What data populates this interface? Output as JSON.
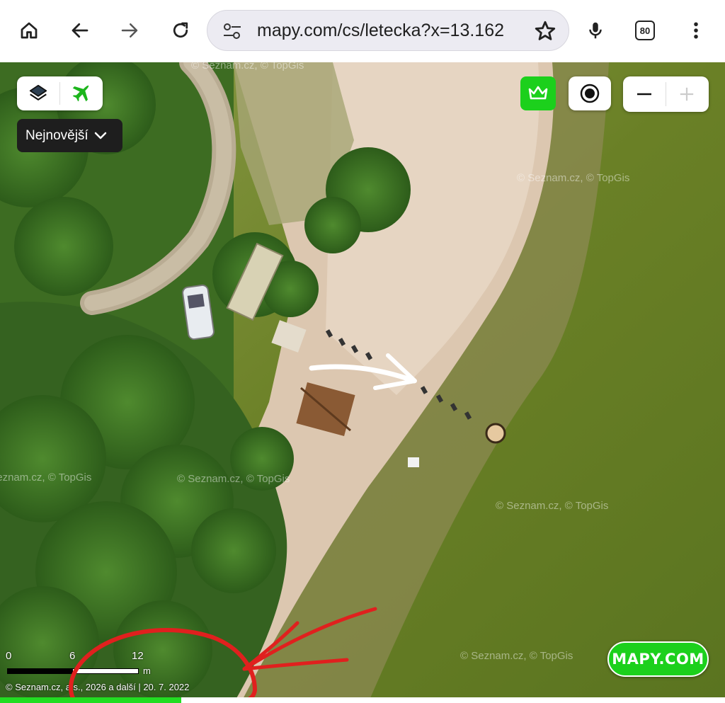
{
  "browser": {
    "url": "mapy.com/cs/letecka?x=13.162",
    "tab_count": "80",
    "icons": [
      "home-icon",
      "back-icon",
      "forward-icon",
      "reload-icon",
      "site-settings-icon",
      "star-icon",
      "mic-icon",
      "tabs-icon",
      "menu-icon"
    ]
  },
  "map": {
    "date_dropdown": "Nejnovější",
    "scale": {
      "labels": [
        "0",
        "6",
        "12"
      ],
      "unit": "m"
    },
    "copyright": "© Seznam.cz, a.s., 2026 a další | 20. 7. 2022",
    "watermark": "© Seznam.cz, © TopGis",
    "logo": "MAPY.COM",
    "colors": {
      "accent": "#1cd01c",
      "annotation_red": "#e0201e",
      "annotation_white": "#ffffff"
    }
  },
  "loading_progress": 0.25
}
